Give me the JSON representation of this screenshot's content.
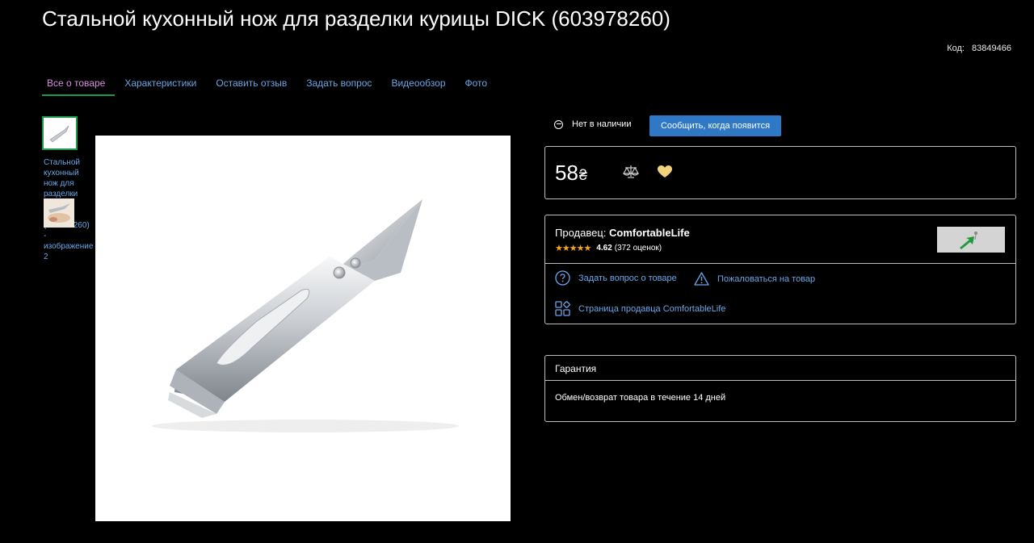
{
  "product": {
    "title": "Стальной кухонный нож для разделки курицы DICK (603978260)",
    "code_label": "Код:",
    "code_value": "83849466"
  },
  "tabs": [
    {
      "label": "Все о товаре",
      "active": true
    },
    {
      "label": "Характеристики"
    },
    {
      "label": "Оставить отзыв"
    },
    {
      "label": "Задать вопрос"
    },
    {
      "label": "Видеообзор"
    },
    {
      "label": "Фото"
    }
  ],
  "gallery": {
    "thumb_caption": "Стальной кухонный нож для разделки курицы DICK (603978260) - изображение 2"
  },
  "availability": {
    "status": "Нет в наличии",
    "notify_button": "Сообщить, когда появится"
  },
  "price": {
    "value": "58",
    "currency": "₴"
  },
  "seller": {
    "label": "Продавец:",
    "name": "ComfortableLife",
    "stars": "★★★★★",
    "rating": "4.62",
    "reviews": "(372 оценок)",
    "ask_link": "Задать вопрос о товаре",
    "complain_link": "Пожаловаться на товар",
    "shop_link": "Страница продавца ComfortableLife"
  },
  "warranty": {
    "heading": "Гарантия",
    "text": "Обмен/возврат товара в течение 14 дней"
  },
  "colors": {
    "background": "#000000",
    "link": "#6aa6e8",
    "active_tab": "#d98fe0",
    "active_underline": "#1a9c4a",
    "button": "#2e78c6",
    "stars": "#f4a51c",
    "heart": "#f2d27a"
  },
  "icons": [
    "minus-circle-icon",
    "compare-scales-icon",
    "heart-icon",
    "question-circle-icon",
    "warning-triangle-icon",
    "grid-shapes-icon",
    "seller-logo-icon"
  ]
}
